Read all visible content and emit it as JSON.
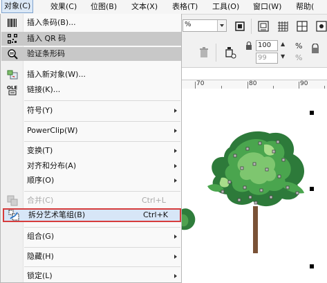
{
  "menubar": {
    "items": [
      "对象(C)",
      "效果(C)",
      "位图(B)",
      "文本(X)",
      "表格(T)",
      "工具(O)",
      "窗口(W)",
      "帮助("
    ]
  },
  "toolbar": {
    "zoom_value": "%",
    "size_w": "100",
    "size_h": "99",
    "percent": "%"
  },
  "ruler": {
    "numbers": [
      "70",
      "80",
      "90"
    ]
  },
  "menu": {
    "items": [
      {
        "label": "插入条码(B)...",
        "icon": "barcode-icon"
      },
      {
        "label": "插入 QR 码",
        "icon": "qr-code-icon"
      },
      {
        "label": "验证条形码",
        "icon": "validate-barcode-icon"
      },
      {
        "label": "插入新对象(W)...",
        "icon": "insert-object-icon"
      },
      {
        "label": "链接(K)...",
        "icon": "ole-link-icon"
      },
      {
        "label": "符号(Y)"
      },
      {
        "label": "PowerClip(W)"
      },
      {
        "label": "变换(T)"
      },
      {
        "label": "对齐和分布(A)"
      },
      {
        "label": "顺序(O)"
      },
      {
        "label": "合并(C)",
        "shortcut": "Ctrl+L",
        "icon": "combine-icon"
      },
      {
        "label": "拆分艺术笔组(B)",
        "shortcut": "Ctrl+K",
        "icon": "break-apart-artistic-icon"
      },
      {
        "label": "组合(G)"
      },
      {
        "label": "隐藏(H)"
      },
      {
        "label": "锁定(L)"
      }
    ]
  },
  "colors": {
    "highlight_border": "#d63c3c",
    "selected_bg": "#d7e6f7",
    "tree_green": "#3f9a47",
    "trunk": "#7a5236"
  }
}
